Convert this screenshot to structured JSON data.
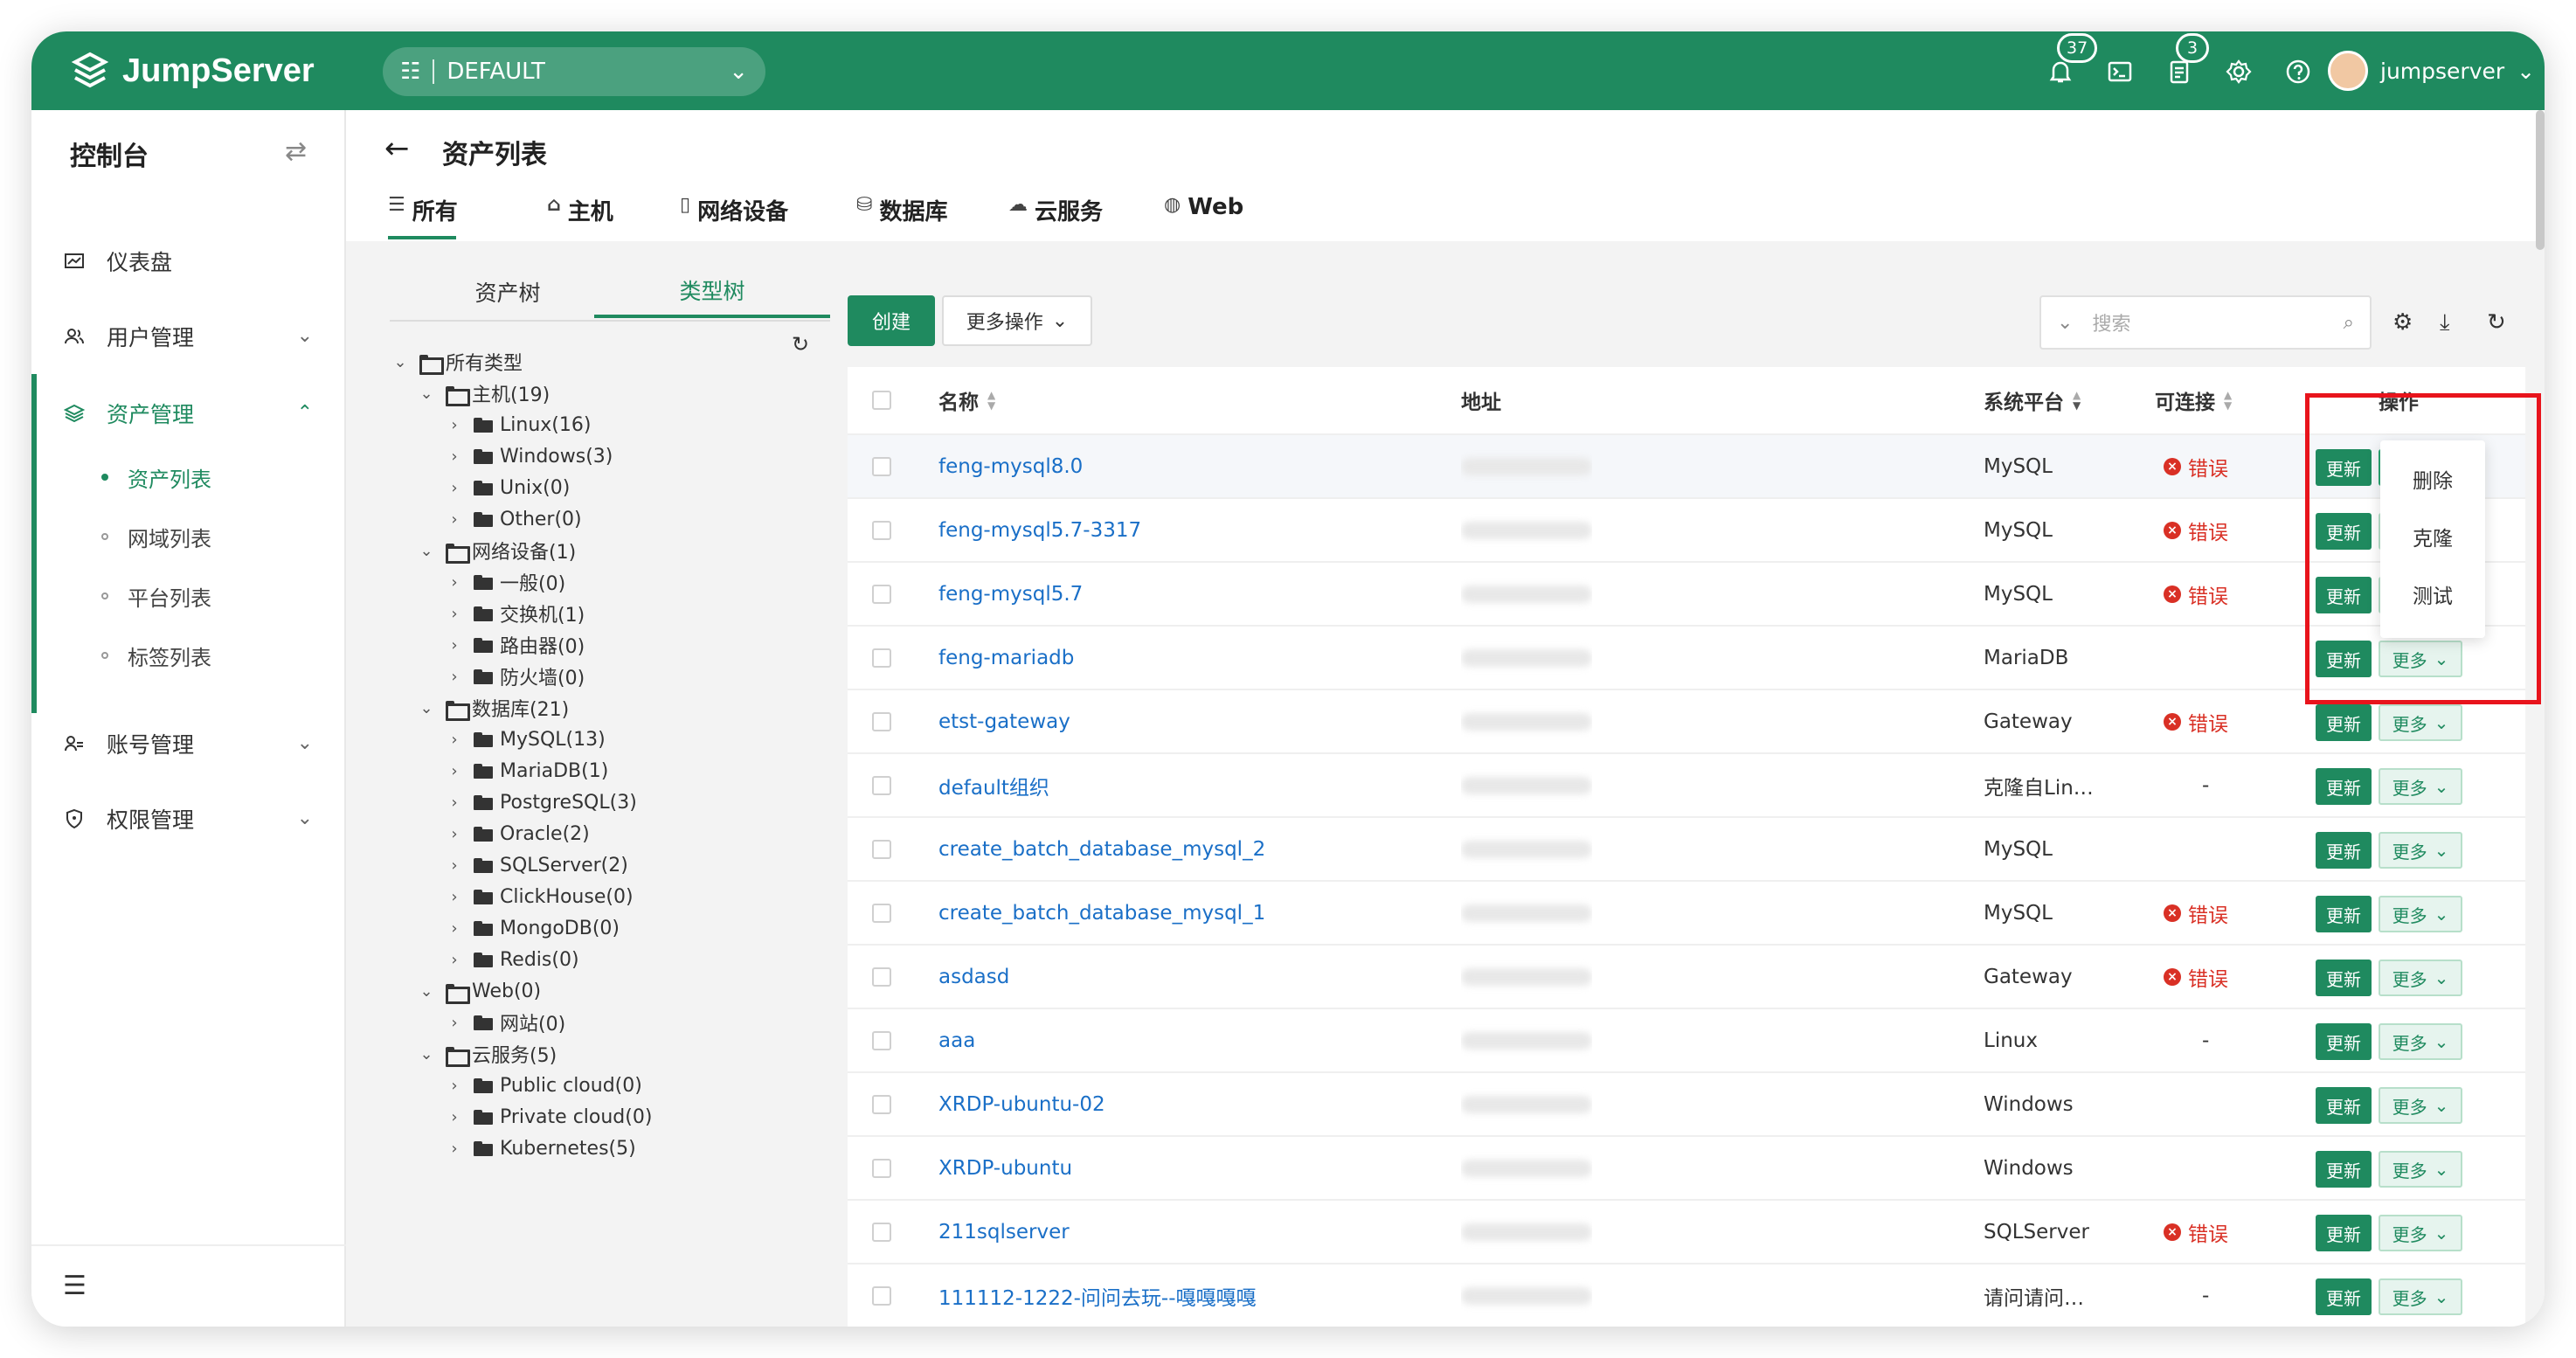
{
  "app": {
    "logo_text": "JumpServer",
    "org": "DEFAULT"
  },
  "topbar": {
    "notifications_badge": "37",
    "tasks_badge": "3",
    "username": "jumpserver"
  },
  "sidebar": {
    "title": "控制台",
    "items": [
      {
        "label": "仪表盘"
      },
      {
        "label": "用户管理"
      },
      {
        "label": "资产管理"
      },
      {
        "label": "账号管理"
      },
      {
        "label": "权限管理"
      }
    ],
    "sub_items": [
      {
        "label": "资产列表"
      },
      {
        "label": "网域列表"
      },
      {
        "label": "平台列表"
      },
      {
        "label": "标签列表"
      }
    ]
  },
  "page": {
    "title": "资产列表",
    "tabs": [
      {
        "label": "所有",
        "icon": "list-icon"
      },
      {
        "label": "主机",
        "icon": "host-icon"
      },
      {
        "label": "网络设备",
        "icon": "device-icon"
      },
      {
        "label": "数据库",
        "icon": "database-icon"
      },
      {
        "label": "云服务",
        "icon": "cloud-icon"
      },
      {
        "label": "Web",
        "icon": "globe-icon"
      }
    ]
  },
  "tree": {
    "tabs": [
      "资产树",
      "类型树"
    ],
    "active_tab": "类型树",
    "nodes": [
      {
        "label": "所有类型",
        "level": 0,
        "open": true
      },
      {
        "label": "主机(19)",
        "level": 1,
        "open": true
      },
      {
        "label": "Linux(16)",
        "level": 2
      },
      {
        "label": "Windows(3)",
        "level": 2
      },
      {
        "label": "Unix(0)",
        "level": 2
      },
      {
        "label": "Other(0)",
        "level": 2
      },
      {
        "label": "网络设备(1)",
        "level": 1,
        "open": true
      },
      {
        "label": "一般(0)",
        "level": 2
      },
      {
        "label": "交换机(1)",
        "level": 2
      },
      {
        "label": "路由器(0)",
        "level": 2
      },
      {
        "label": "防火墙(0)",
        "level": 2
      },
      {
        "label": "数据库(21)",
        "level": 1,
        "open": true
      },
      {
        "label": "MySQL(13)",
        "level": 2
      },
      {
        "label": "MariaDB(1)",
        "level": 2
      },
      {
        "label": "PostgreSQL(3)",
        "level": 2
      },
      {
        "label": "Oracle(2)",
        "level": 2
      },
      {
        "label": "SQLServer(2)",
        "level": 2
      },
      {
        "label": "ClickHouse(0)",
        "level": 2
      },
      {
        "label": "MongoDB(0)",
        "level": 2
      },
      {
        "label": "Redis(0)",
        "level": 2
      },
      {
        "label": "Web(0)",
        "level": 1,
        "open": true
      },
      {
        "label": "网站(0)",
        "level": 2
      },
      {
        "label": "云服务(5)",
        "level": 1,
        "open": true
      },
      {
        "label": "Public cloud(0)",
        "level": 2
      },
      {
        "label": "Private cloud(0)",
        "level": 2
      },
      {
        "label": "Kubernetes(5)",
        "level": 2
      }
    ]
  },
  "toolbar": {
    "create_label": "创建",
    "more_ops_label": "更多操作",
    "search_placeholder": "搜索"
  },
  "table": {
    "columns": {
      "name": "名称",
      "address": "地址",
      "platform": "系统平台",
      "connectable": "可连接",
      "actions": "操作"
    },
    "update_label": "更新",
    "more_label": "更多",
    "error_label": "错误",
    "rows": [
      {
        "name": "feng-mysql8.0",
        "platform": "MySQL",
        "status": "error"
      },
      {
        "name": "feng-mysql5.7-3317",
        "platform": "MySQL",
        "status": "error"
      },
      {
        "name": "feng-mysql5.7",
        "platform": "MySQL",
        "status": "error"
      },
      {
        "name": "feng-mariadb",
        "platform": "MariaDB",
        "status": ""
      },
      {
        "name": "etst-gateway",
        "platform": "Gateway",
        "status": "error"
      },
      {
        "name": "default组织",
        "platform": "克隆自Lin…",
        "status": "-"
      },
      {
        "name": "create_batch_database_mysql_2",
        "platform": "MySQL",
        "status": ""
      },
      {
        "name": "create_batch_database_mysql_1",
        "platform": "MySQL",
        "status": "error"
      },
      {
        "name": "asdasd",
        "platform": "Gateway",
        "status": "error"
      },
      {
        "name": "aaa",
        "platform": "Linux",
        "status": "-"
      },
      {
        "name": "XRDP-ubuntu-02",
        "platform": "Windows",
        "status": ""
      },
      {
        "name": "XRDP-ubuntu",
        "platform": "Windows",
        "status": ""
      },
      {
        "name": "211sqlserver",
        "platform": "SQLServer",
        "status": "error"
      },
      {
        "name": "111112-1222-问问去玩--嘎嘎嘎嘎",
        "platform": "请问请问…",
        "status": "-"
      }
    ]
  },
  "dropdown": {
    "items": [
      "删除",
      "克隆",
      "测试"
    ]
  },
  "colors": {
    "brand": "#1f8a5f",
    "error": "#d93025",
    "link": "#1a6fc7",
    "highlight_box": "#e8141c"
  }
}
